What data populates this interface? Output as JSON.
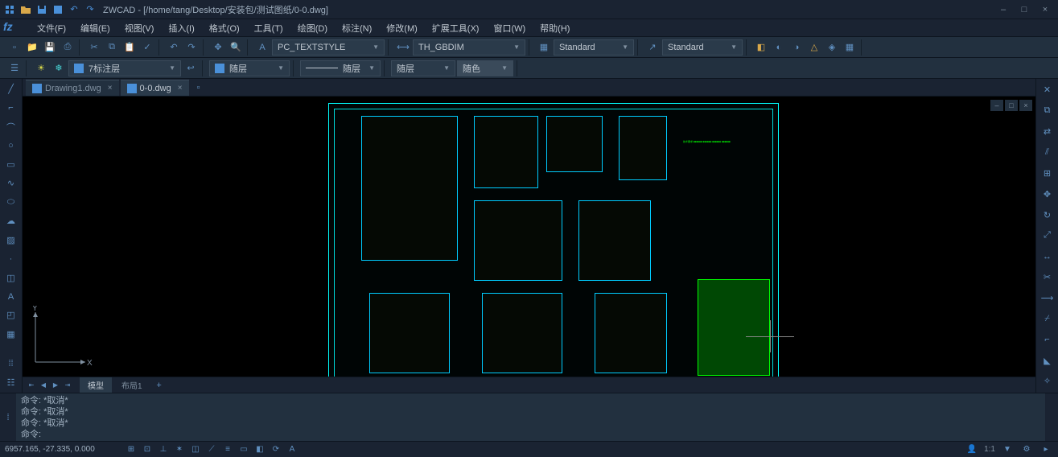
{
  "title": "ZWCAD - [/home/tang/Desktop/安装包/测试图纸/0-0.dwg]",
  "menu": {
    "file": "文件(F)",
    "edit": "编辑(E)",
    "view": "视图(V)",
    "insert": "插入(I)",
    "format": "格式(O)",
    "tools": "工具(T)",
    "draw": "绘图(D)",
    "dimension": "标注(N)",
    "modify": "修改(M)",
    "ext": "扩展工具(X)",
    "window": "窗口(W)",
    "help": "帮助(H)"
  },
  "toolbar": {
    "textstyle": "PC_TEXTSTYLE",
    "dimstyle": "TH_GBDIM",
    "tablestyle": "Standard",
    "leaderstyle": "Standard",
    "layer": "7标注层",
    "linetype": "随层",
    "lineweight": "随层",
    "color_label": "随层",
    "color_swatch": "随色"
  },
  "tabs": {
    "tab1": "Drawing1.dwg",
    "tab2": "0-0.dwg"
  },
  "layout": {
    "model": "模型",
    "layout1": "布局1"
  },
  "command": {
    "line1": "命令: *取消*",
    "line2": "命令: *取消*",
    "line3": "命令: *取消*",
    "prompt": "命令:"
  },
  "status": {
    "coords": "6957.165, -27.335, 0.000",
    "scale": "1:1"
  },
  "ucs": {
    "x": "X",
    "y": "Y"
  }
}
